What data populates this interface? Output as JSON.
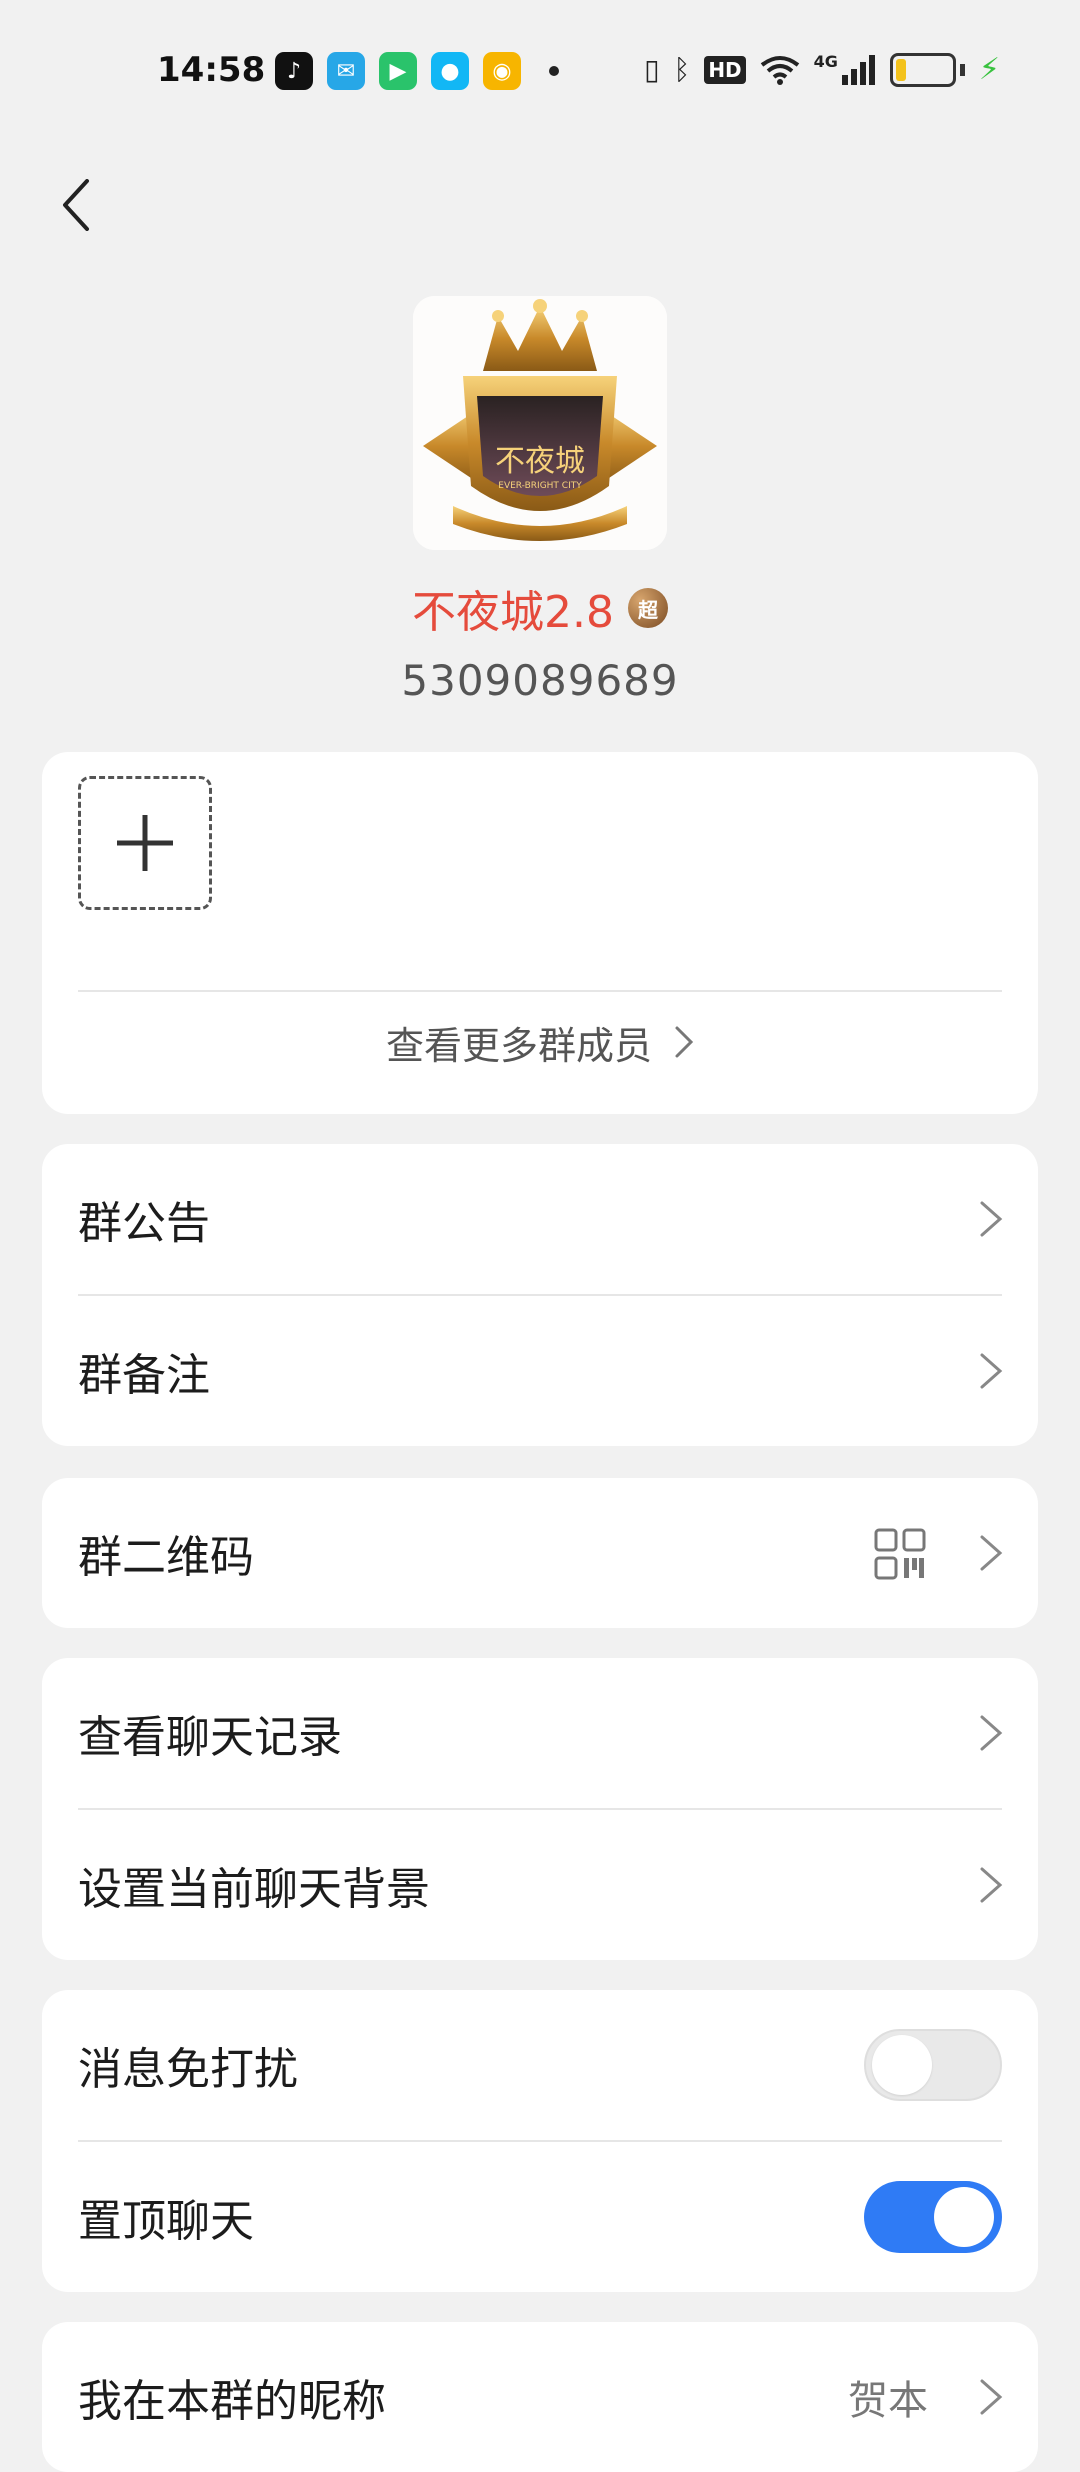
{
  "status_bar": {
    "time": "14:58",
    "apps": [
      {
        "icon": "tiktok-icon",
        "glyph": "♪",
        "color": "#111111"
      },
      {
        "icon": "bird-app-icon",
        "glyph": "✉",
        "color": "#27a7e7"
      },
      {
        "icon": "video-app-icon",
        "glyph": "▶",
        "color": "#2ac36b"
      },
      {
        "icon": "qq-icon",
        "glyph": "●",
        "color": "#12b7f5"
      },
      {
        "icon": "weibo-icon",
        "glyph": "◉",
        "color": "#f7b500"
      }
    ],
    "network": "4G",
    "hd_label": "HD"
  },
  "header": {
    "group_name": "不夜城2.8",
    "badge": "超",
    "group_id": "5309089689"
  },
  "members_card": {
    "more_members": "查看更多群成员"
  },
  "menu": {
    "announcement": "群公告",
    "remark": "群备注",
    "qr_code": "群二维码",
    "chat_history": "查看聊天记录",
    "chat_background": "设置当前聊天背景",
    "do_not_disturb": "消息免打扰",
    "pin_chat": "置顶聊天",
    "my_nickname": "我在本群的昵称",
    "my_nickname_value": "贺本"
  },
  "toggles": {
    "do_not_disturb": false,
    "pin_chat": true
  },
  "colors": {
    "background": "#f1f1f1",
    "group_name": "#e54b3c",
    "toggle_on": "#2f7bf5"
  }
}
